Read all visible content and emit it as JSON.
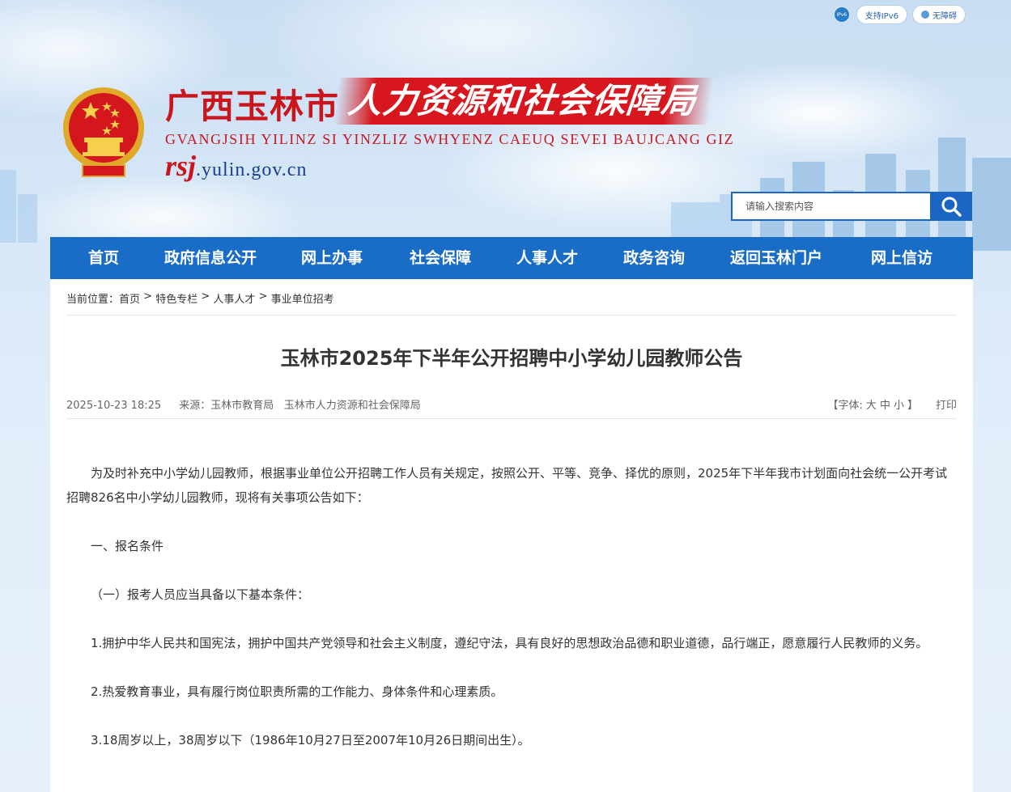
{
  "util": {
    "ipv6_badge": "IPv6",
    "ipv6_label": "支持IPv6",
    "accessibility_label": "无障碍"
  },
  "header": {
    "title_part1": "广西玉林市",
    "title_part2": "人力资源和社会保障局",
    "title_en": "GVANGJSIH YILINZ SI YINZLIZ SWHYENZ CAEUQ SEVEI BAUJCANG GIZ",
    "domain_prefix": "rsj",
    "domain_suffix": ".yulin.gov.cn"
  },
  "search": {
    "placeholder": "请输入搜索内容"
  },
  "nav": [
    {
      "label": "首页"
    },
    {
      "label": "政府信息公开"
    },
    {
      "label": "网上办事"
    },
    {
      "label": "社会保障"
    },
    {
      "label": "人事人才"
    },
    {
      "label": "政务咨询"
    },
    {
      "label": "返回玉林门户"
    },
    {
      "label": "网上信访"
    }
  ],
  "breadcrumb": {
    "prefix": "当前位置：",
    "items": [
      "首页",
      "特色专栏",
      "人事人才",
      "事业单位招考"
    ],
    "separator": " > "
  },
  "article": {
    "title": "玉林市2025年下半年公开招聘中小学幼儿园教师公告",
    "datetime": "2025-10-23 18:25",
    "source": "来源：玉林市教育局   玉林市人力资源和社会保障局",
    "font_prefix": "【字体:",
    "font_large": "大",
    "font_medium": "中",
    "font_small": "小",
    "font_suffix": "】",
    "print": "打印",
    "paragraphs": [
      "为及时补充中小学幼儿园教师，根据事业单位公开招聘工作人员有关规定，按照公开、平等、竞争、择优的原则，2025年下半年我市计划面向社会统一公开考试招聘826名中小学幼儿园教师，现将有关事项公告如下：",
      "一、报名条件",
      "（一）报考人员应当具备以下基本条件：",
      "1.拥护中华人民共和国宪法，拥护中国共产党领导和社会主义制度，遵纪守法，具有良好的思想政治品德和职业道德，品行端正，愿意履行人民教师的义务。",
      "2.热爱教育事业，具有履行岗位职责所需的工作能力、身体条件和心理素质。",
      "3.18周岁以上，38周岁以下（1986年10月27日至2007年10月26日期间出生）。"
    ]
  },
  "colors": {
    "nav_blue": "#1a6dc7",
    "brand_red": "#c9161d"
  }
}
